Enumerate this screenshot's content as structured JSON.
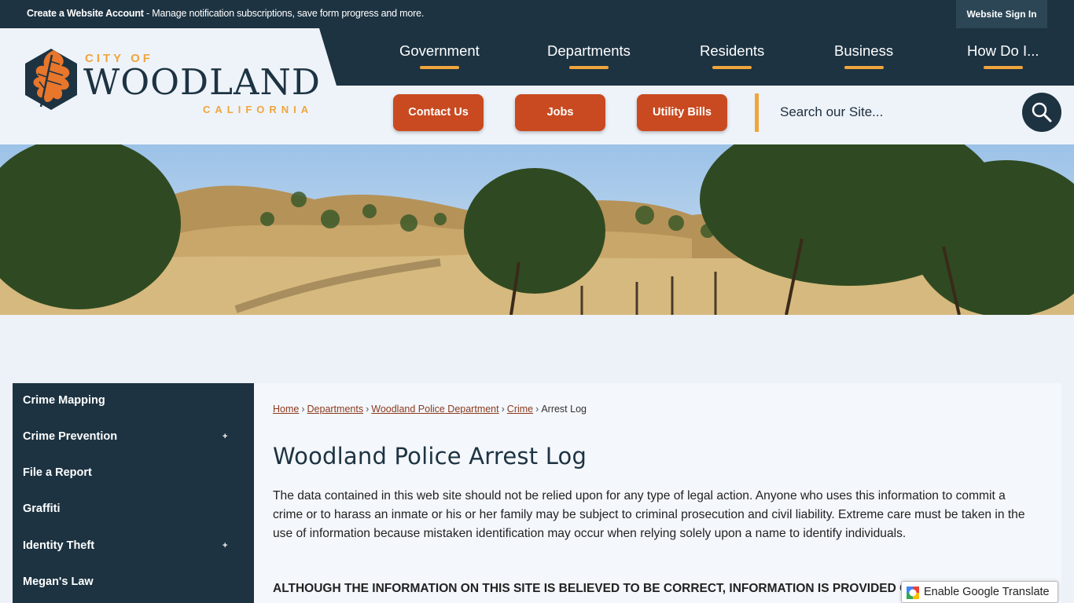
{
  "topbar": {
    "create_label": "Create a Website Account",
    "message": " - Manage notification subscriptions, save form progress and more.",
    "signin_label": "Website Sign In"
  },
  "logo": {
    "city_of": "CITY OF",
    "name": "WOODLAND",
    "state": "CALIFORNIA"
  },
  "nav": {
    "items": [
      {
        "label": "Government"
      },
      {
        "label": "Departments"
      },
      {
        "label": "Residents"
      },
      {
        "label": "Business"
      },
      {
        "label": "How Do I..."
      }
    ]
  },
  "quicklinks": [
    {
      "label": "Contact Us"
    },
    {
      "label": "Jobs"
    },
    {
      "label": "Utility Bills"
    }
  ],
  "search": {
    "placeholder": "Search our Site..."
  },
  "sidebar": {
    "items": [
      {
        "label": "Crime Mapping",
        "expandable": false
      },
      {
        "label": "Crime Prevention",
        "expandable": true
      },
      {
        "label": "File a Report",
        "expandable": false
      },
      {
        "label": "Graffiti",
        "expandable": false
      },
      {
        "label": "Identity Theft",
        "expandable": true
      },
      {
        "label": "Megan's Law",
        "expandable": false
      }
    ],
    "expand_glyph": "+"
  },
  "breadcrumb": {
    "links": [
      "Home",
      "Departments",
      "Woodland Police Department",
      "Crime"
    ],
    "current": "Arrest Log",
    "separator": "›"
  },
  "page": {
    "title": "Woodland Police Arrest Log",
    "paragraph": "The data contained in this web site should not be relied upon for any type of legal action. Anyone who uses this information to commit a crime or to harass an inmate or his or her family may be subject to criminal prosecution and civil liability. Extreme care must be taken in the use of information because mistaken identification may occur when relying solely upon a name to identify individuals.",
    "caps_notice": "ALTHOUGH THE INFORMATION ON THIS SITE IS BELIEVED TO BE CORRECT, INFORMATION IS PROVIDED C"
  },
  "translate": {
    "label": "Enable Google Translate"
  },
  "colors": {
    "navy": "#1d3342",
    "accent_orange": "#f0a53c",
    "button_rust": "#c94a20",
    "link": "#8a3a1e"
  }
}
